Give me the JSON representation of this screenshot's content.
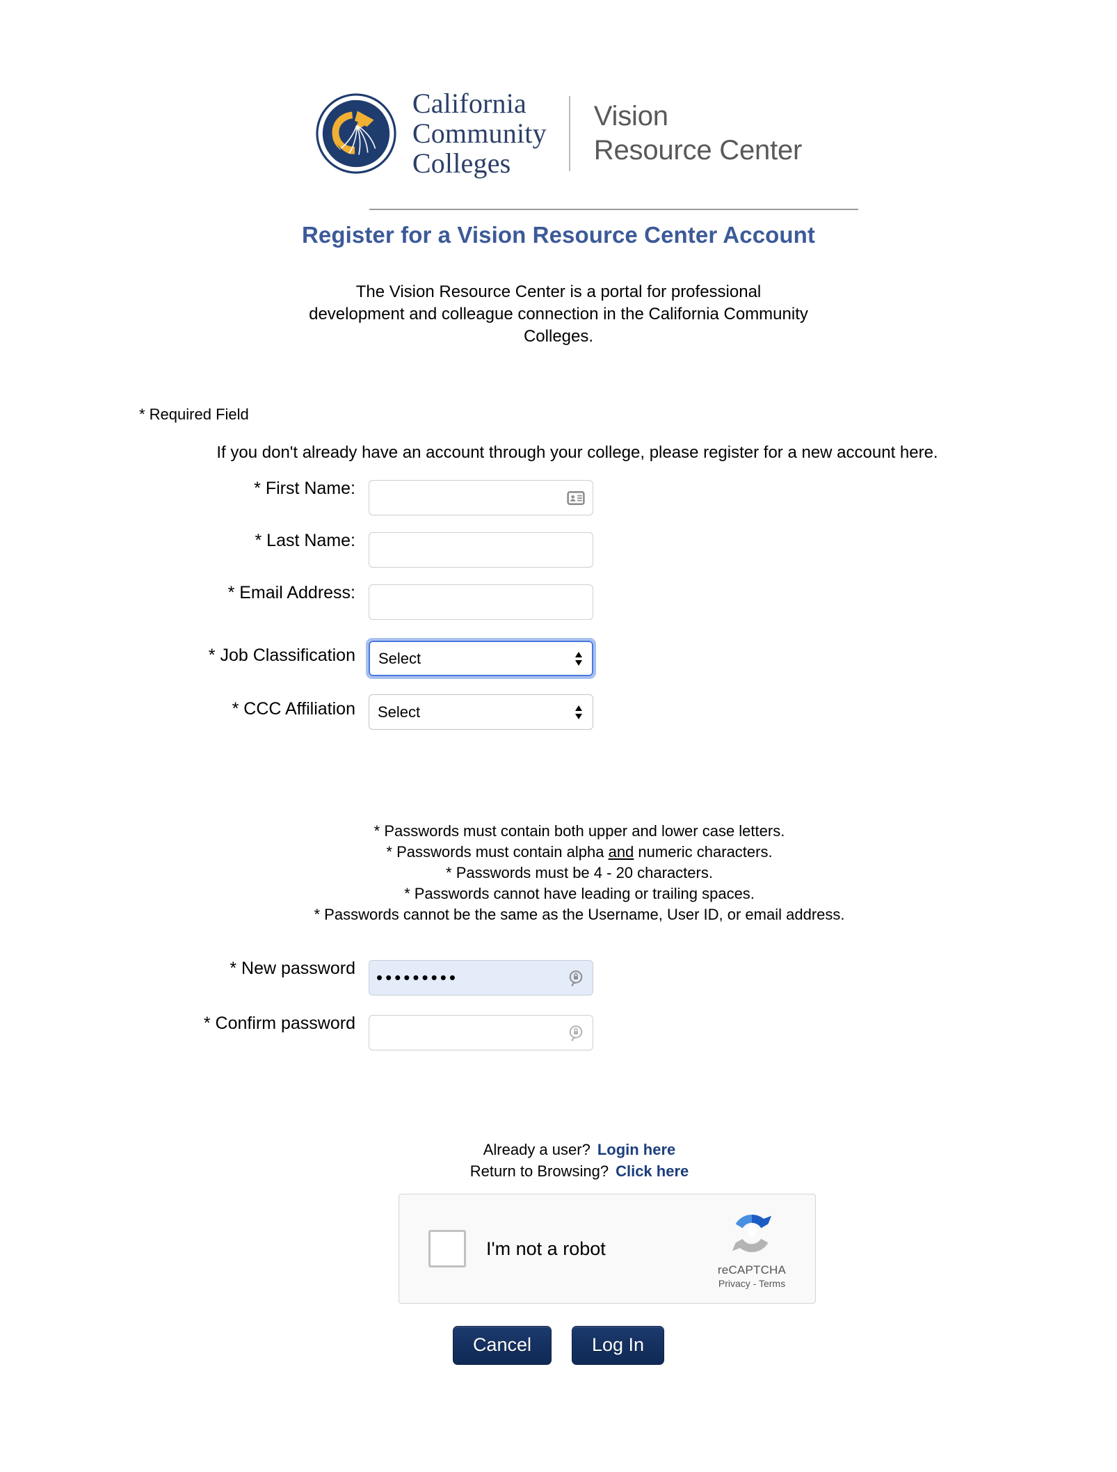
{
  "brand": {
    "org_line1": "California",
    "org_line2": "Community",
    "org_line3": "Colleges",
    "product_line1": "Vision",
    "product_line2": "Resource Center",
    "org_color": "#2c3f66",
    "product_color": "#595959",
    "seal_navy": "#1f3c6e",
    "seal_gold": "#f0b034"
  },
  "header": {
    "title": "Register for a Vision Resource Center Account",
    "intro": "The Vision Resource Center is a portal for professional development and colleague connection in the California Community Colleges."
  },
  "form": {
    "required_note": "* Required Field",
    "register_note": "If you don't already have an account through your college, please register for a new account here.",
    "fields": [
      {
        "label": "* First Name:",
        "value": "",
        "placeholder": "",
        "icon": "contact-card-icon"
      },
      {
        "label": "* Last Name:",
        "value": "",
        "placeholder": "",
        "icon": ""
      },
      {
        "label": "* Email Address:",
        "value": "",
        "placeholder": "",
        "icon": ""
      }
    ],
    "selects": [
      {
        "label": "* Job Classification",
        "value": "Select",
        "focused": true,
        "options": [
          "Select"
        ]
      },
      {
        "label": "* CCC Affiliation",
        "value": "Select",
        "focused": false,
        "options": [
          "Select"
        ]
      }
    ],
    "password_rules": [
      "* Passwords must contain both upper and lower case letters.",
      "* Passwords must contain alpha and numeric characters.",
      "* Passwords must be 4 - 20 characters.",
      "* Passwords cannot have leading or trailing spaces.",
      "* Passwords cannot be the same as the Username, User ID, or email address."
    ],
    "password_rule2_parts": {
      "before": "* Passwords must contain alpha ",
      "underlined": "and",
      "after": " numeric characters."
    },
    "passwords": [
      {
        "label": "* New password",
        "value": "•••••••••",
        "autofilled": true,
        "icon": "password-key-icon"
      },
      {
        "label": "* Confirm password",
        "value": "",
        "autofilled": false,
        "icon": "password-key-icon"
      }
    ]
  },
  "links": {
    "already_user_text": "Already a user?",
    "already_user_link": "Login here",
    "return_browsing_text": "Return to Browsing?",
    "return_browsing_link": "Click here",
    "link_color": "#1c3f7c"
  },
  "recaptcha": {
    "label": "I'm not a robot",
    "brand": "reCAPTCHA",
    "legal": "Privacy - Terms",
    "checked": false
  },
  "buttons": {
    "cancel": "Cancel",
    "login": "Log In",
    "color": "#14305f"
  }
}
